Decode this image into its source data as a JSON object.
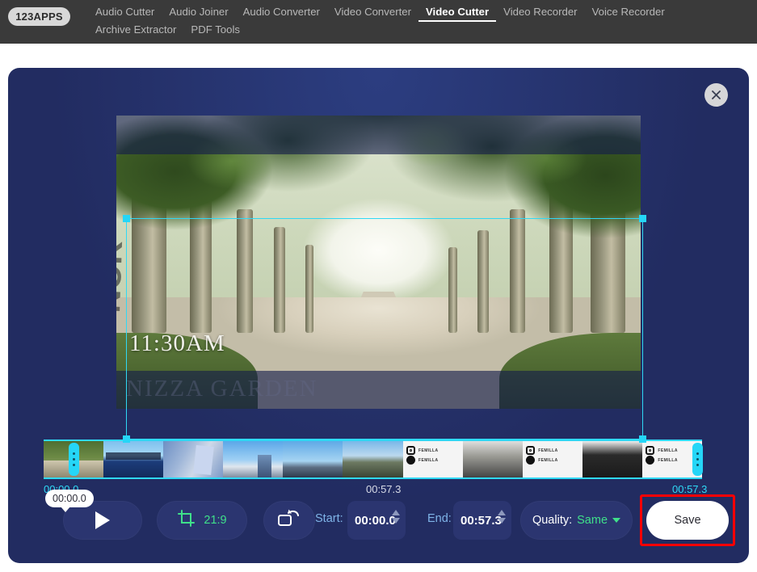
{
  "nav": {
    "logo": "123APPS",
    "items": [
      {
        "label": "Audio Cutter",
        "active": false
      },
      {
        "label": "Audio Joiner",
        "active": false
      },
      {
        "label": "Audio Converter",
        "active": false
      },
      {
        "label": "Video Converter",
        "active": false
      },
      {
        "label": "Video Cutter",
        "active": true
      },
      {
        "label": "Video Recorder",
        "active": false
      },
      {
        "label": "Voice Recorder",
        "active": false
      },
      {
        "label": "Archive Extractor",
        "active": false
      },
      {
        "label": "PDF Tools",
        "active": false
      }
    ]
  },
  "panel": {
    "close_icon": "close-icon",
    "accent_cyan": "#2fd9f5",
    "accent_green": "#3fe08a",
    "background": "#222c61",
    "highlight_box_color": "#ff0000"
  },
  "preview": {
    "overlay_timestamp": "11:30AM",
    "overlay_title": "NIZZA GARDEN",
    "graffiti_text": "NOK",
    "crop_selection": {
      "handles": [
        "top-left",
        "top-right",
        "bottom-left",
        "bottom-right"
      ],
      "border_color": "#2fd9f5"
    }
  },
  "timeline": {
    "tooltip": "00:00.0",
    "label_start": "00:00.0",
    "label_middle": "00:57.3",
    "label_end": "00:57.3",
    "handle_left_icon": "drag-handle-icon",
    "handle_right_icon": "drag-handle-icon",
    "thumbnails": [
      {
        "name": "tree-avenue",
        "class": "t-trees"
      },
      {
        "name": "lake-skyline",
        "class": "t-lake"
      },
      {
        "name": "hand-flyer",
        "class": "t-hand"
      },
      {
        "name": "city-tower",
        "class": "t-city"
      },
      {
        "name": "bridge",
        "class": "t-bridge"
      },
      {
        "name": "road",
        "class": "t-road"
      },
      {
        "name": "phone-ui-1",
        "class": "t-phone"
      },
      {
        "name": "screenshot-1",
        "class": "t-shot"
      },
      {
        "name": "phone-ui-2",
        "class": "t-phone"
      },
      {
        "name": "screenshot-2",
        "class": "t-shot2"
      },
      {
        "name": "phone-ui-3",
        "class": "t-phone"
      }
    ],
    "phone_rows": [
      {
        "icon": "instagram-icon",
        "label": "FEMILLA"
      },
      {
        "icon": "snapchat-icon",
        "label": "FEMILLA"
      }
    ]
  },
  "controls": {
    "play_icon": "play-icon",
    "crop_icon": "crop-icon",
    "crop_ratio": "21:9",
    "rotate_icon": "rotate-icon",
    "start_label": "Start:",
    "start_value": "00:00.0",
    "end_label": "End:",
    "end_value": "00:57.3",
    "quality_label": "Quality:",
    "quality_value": "Same",
    "quality_caret_icon": "chevron-down-icon",
    "save_label": "Save"
  }
}
